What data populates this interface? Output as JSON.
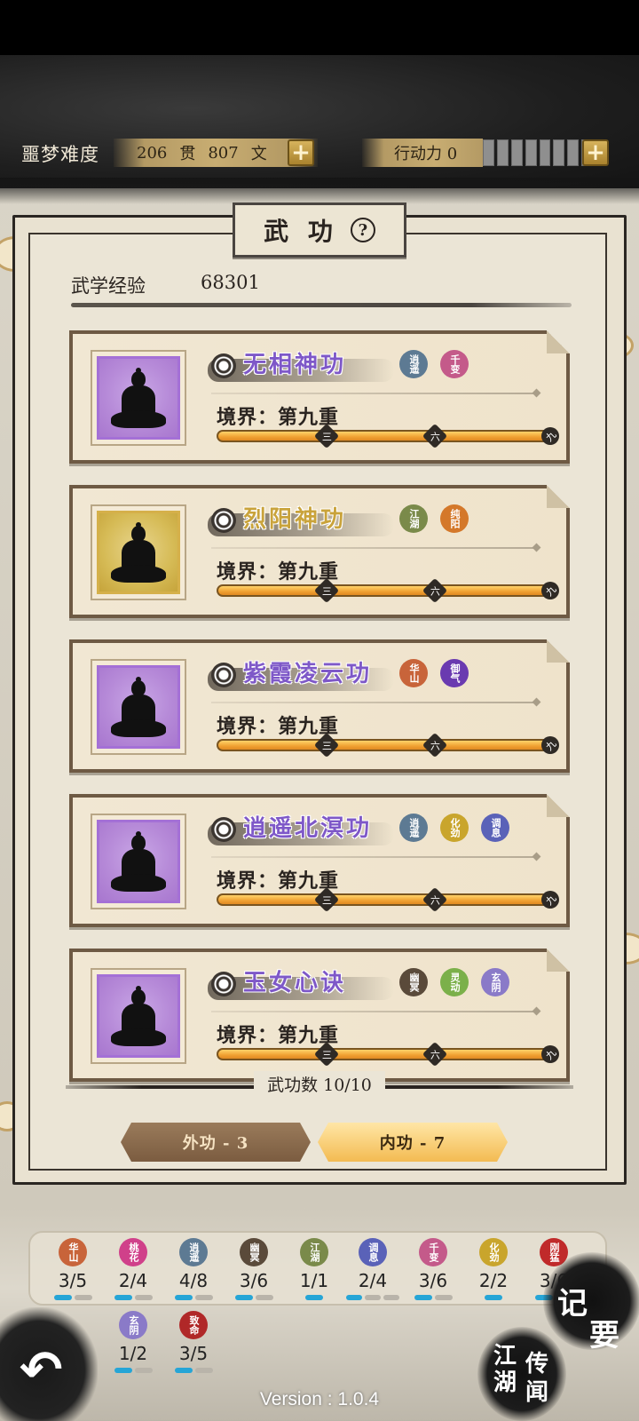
{
  "hud": {
    "difficulty": "噩梦难度",
    "money_guan": "206",
    "money_guan_unit": "贯",
    "money_wen": "807",
    "money_wen_unit": "文",
    "stamina": "行动力 0"
  },
  "panel": {
    "title": "武 功",
    "help": "?",
    "exp_label": "武学经验",
    "exp_value": "68301"
  },
  "skills": [
    {
      "name": "无相神功",
      "realm": "境界：第九重",
      "tags": [
        "逍遥",
        "千变"
      ],
      "tag_colors": [
        "#5d7a93",
        "#c45a8a"
      ]
    },
    {
      "name": "烈阳神功",
      "realm": "境界：第九重",
      "tags": [
        "江湖",
        "纯阳"
      ],
      "tag_colors": [
        "#7a8a4a",
        "#d4782a"
      ]
    },
    {
      "name": "紫霞凌云功",
      "realm": "境界：第九重",
      "tags": [
        "华山",
        "御气"
      ],
      "tag_colors": [
        "#c8643a",
        "#6a3ab0"
      ]
    },
    {
      "name": "逍遥北溟功",
      "realm": "境界：第九重",
      "tags": [
        "逍遥",
        "化劲",
        "调息"
      ],
      "tag_colors": [
        "#5d7a93",
        "#c9a52c",
        "#5a62b8"
      ]
    },
    {
      "name": "玉女心诀",
      "realm": "境界：第九重",
      "tags": [
        "幽冥",
        "灵动",
        "玄阴"
      ],
      "tag_colors": [
        "#5a4a3a",
        "#7bb04a",
        "#8a7ac8"
      ]
    }
  ],
  "progress": {
    "m1": "三",
    "m2": "六",
    "m3": "九",
    "level_fraction": 1.0
  },
  "count": "武功数 10/10",
  "buttons": {
    "outer": "外功 - 3",
    "inner": "内功 - 7"
  },
  "attributes": [
    {
      "name": "华山",
      "value": "3/5",
      "color": "#c8643a",
      "pips": [
        1,
        0
      ]
    },
    {
      "name": "桃花",
      "value": "2/4",
      "color": "#d0408a",
      "pips": [
        1,
        0
      ]
    },
    {
      "name": "逍遥",
      "value": "4/8",
      "color": "#5d7a93",
      "pips": [
        1,
        0
      ]
    },
    {
      "name": "幽冥",
      "value": "3/6",
      "color": "#5a4a3a",
      "pips": [
        1,
        0
      ]
    },
    {
      "name": "江湖",
      "value": "1/1",
      "color": "#7a8a4a",
      "pips": [
        1
      ]
    },
    {
      "name": "调息",
      "value": "2/4",
      "color": "#5a62b8",
      "pips": [
        1,
        0,
        0
      ]
    },
    {
      "name": "千变",
      "value": "3/6",
      "color": "#c45a8a",
      "pips": [
        1,
        0
      ]
    },
    {
      "name": "化劲",
      "value": "2/2",
      "color": "#c9a52c",
      "pips": [
        1
      ]
    },
    {
      "name": "刚猛",
      "value": "3/6",
      "color": "#c02a2a",
      "pips": [
        1,
        0
      ]
    },
    {
      "name": "玄阴",
      "value": "1/2",
      "color": "#8a7ac8",
      "pips": [
        1,
        0
      ]
    },
    {
      "name": "致命",
      "value": "3/5",
      "color": "#b02828",
      "pips": [
        1,
        0
      ]
    }
  ],
  "side": {
    "notes": "记 要",
    "rumors1": "传",
    "rumors2": "闻",
    "jianghu1": "江",
    "jianghu2": "湖"
  },
  "version": "Version : 1.0.4"
}
